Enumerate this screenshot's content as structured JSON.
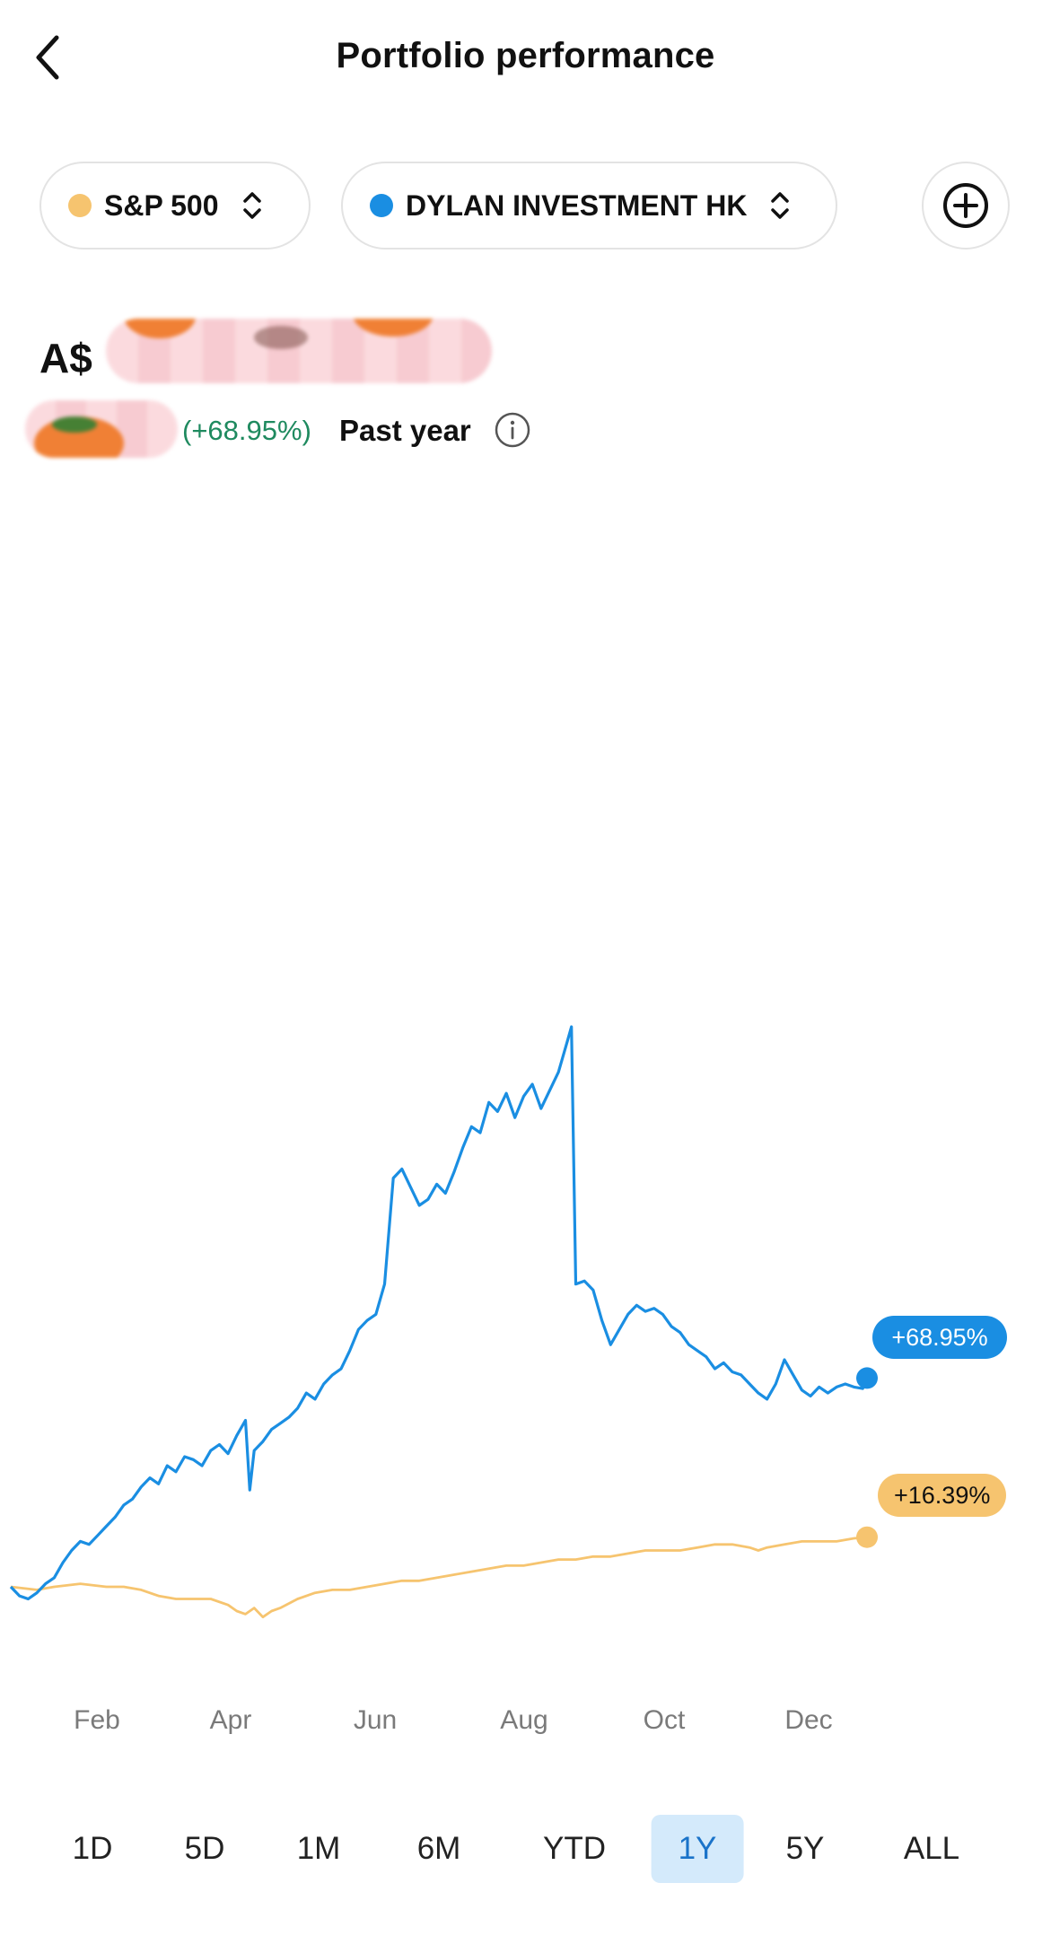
{
  "header": {
    "title": "Portfolio performance"
  },
  "comparison": [
    {
      "label": "S&P 500",
      "color": "#f6c46f"
    },
    {
      "label": "DYLAN INVESTMENT HK",
      "color": "#1a8ee2"
    }
  ],
  "icons": {
    "back": "back-chevron-icon",
    "sort": "sort-updown-icon",
    "add": "add-circle-icon",
    "info": "info-icon"
  },
  "summary": {
    "currency": "A$",
    "change_percent": "(+68.95%)",
    "period": "Past year"
  },
  "chart_data": {
    "type": "line",
    "x_ticks": [
      "Feb",
      "Apr",
      "Jun",
      "Aug",
      "Oct",
      "Dec"
    ],
    "series": [
      {
        "name": "DYLAN INVESTMENT HK",
        "color": "#1a8ee2",
        "end_label": "+68.95%",
        "points": [
          [
            0,
            0
          ],
          [
            1,
            -3
          ],
          [
            2,
            -4
          ],
          [
            3,
            -2
          ],
          [
            4,
            1
          ],
          [
            5,
            3
          ],
          [
            6,
            8
          ],
          [
            7,
            12
          ],
          [
            8,
            15
          ],
          [
            9,
            14
          ],
          [
            10,
            17
          ],
          [
            11,
            20
          ],
          [
            12,
            23
          ],
          [
            13,
            27
          ],
          [
            14,
            29
          ],
          [
            15,
            33
          ],
          [
            16,
            36
          ],
          [
            17,
            34
          ],
          [
            18,
            40
          ],
          [
            19,
            38
          ],
          [
            20,
            43
          ],
          [
            21,
            42
          ],
          [
            22,
            40
          ],
          [
            23,
            45
          ],
          [
            24,
            47
          ],
          [
            25,
            44
          ],
          [
            26,
            50
          ],
          [
            27,
            55
          ],
          [
            27.5,
            32
          ],
          [
            28,
            45
          ],
          [
            29,
            48
          ],
          [
            30,
            52
          ],
          [
            31,
            54
          ],
          [
            32,
            56
          ],
          [
            33,
            59
          ],
          [
            34,
            64
          ],
          [
            35,
            62
          ],
          [
            36,
            67
          ],
          [
            37,
            70
          ],
          [
            38,
            72
          ],
          [
            39,
            78
          ],
          [
            40,
            85
          ],
          [
            41,
            88
          ],
          [
            42,
            90
          ],
          [
            43,
            100
          ],
          [
            44,
            135
          ],
          [
            45,
            138
          ],
          [
            46,
            132
          ],
          [
            47,
            126
          ],
          [
            48,
            128
          ],
          [
            49,
            133
          ],
          [
            50,
            130
          ],
          [
            51,
            137
          ],
          [
            52,
            145
          ],
          [
            53,
            152
          ],
          [
            54,
            150
          ],
          [
            55,
            160
          ],
          [
            56,
            157
          ],
          [
            57,
            163
          ],
          [
            58,
            155
          ],
          [
            59,
            162
          ],
          [
            60,
            166
          ],
          [
            61,
            158
          ],
          [
            62,
            164
          ],
          [
            63,
            170
          ],
          [
            64,
            180
          ],
          [
            64.5,
            185
          ],
          [
            65,
            100
          ],
          [
            66,
            101
          ],
          [
            67,
            98
          ],
          [
            68,
            88
          ],
          [
            69,
            80
          ],
          [
            70,
            85
          ],
          [
            71,
            90
          ],
          [
            72,
            93
          ],
          [
            73,
            91
          ],
          [
            74,
            92
          ],
          [
            75,
            90
          ],
          [
            76,
            86
          ],
          [
            77,
            84
          ],
          [
            78,
            80
          ],
          [
            79,
            78
          ],
          [
            80,
            76
          ],
          [
            81,
            72
          ],
          [
            82,
            74
          ],
          [
            83,
            71
          ],
          [
            84,
            70
          ],
          [
            85,
            67
          ],
          [
            86,
            64
          ],
          [
            87,
            62
          ],
          [
            88,
            67
          ],
          [
            89,
            75
          ],
          [
            90,
            70
          ],
          [
            91,
            65
          ],
          [
            92,
            63
          ],
          [
            93,
            66
          ],
          [
            94,
            64
          ],
          [
            95,
            66
          ],
          [
            96,
            67
          ],
          [
            97,
            66
          ],
          [
            98,
            65.5
          ],
          [
            98.5,
            68.95
          ]
        ]
      },
      {
        "name": "S&P 500",
        "color": "#f6c46f",
        "end_label": "+16.39%",
        "points": [
          [
            0,
            0
          ],
          [
            3,
            -1
          ],
          [
            5,
            0
          ],
          [
            8,
            1
          ],
          [
            11,
            0
          ],
          [
            13,
            0
          ],
          [
            15,
            -1
          ],
          [
            17,
            -3
          ],
          [
            19,
            -4
          ],
          [
            21,
            -4
          ],
          [
            23,
            -4
          ],
          [
            25,
            -6
          ],
          [
            26,
            -8
          ],
          [
            27,
            -9
          ],
          [
            28,
            -7
          ],
          [
            29,
            -10
          ],
          [
            30,
            -8
          ],
          [
            31,
            -7
          ],
          [
            33,
            -4
          ],
          [
            35,
            -2
          ],
          [
            37,
            -1
          ],
          [
            39,
            -1
          ],
          [
            41,
            0
          ],
          [
            43,
            1
          ],
          [
            45,
            2
          ],
          [
            47,
            2
          ],
          [
            49,
            3
          ],
          [
            51,
            4
          ],
          [
            53,
            5
          ],
          [
            55,
            6
          ],
          [
            57,
            7
          ],
          [
            59,
            7
          ],
          [
            61,
            8
          ],
          [
            63,
            9
          ],
          [
            65,
            9
          ],
          [
            67,
            10
          ],
          [
            69,
            10
          ],
          [
            71,
            11
          ],
          [
            73,
            12
          ],
          [
            75,
            12
          ],
          [
            77,
            12
          ],
          [
            79,
            13
          ],
          [
            81,
            14
          ],
          [
            83,
            14
          ],
          [
            85,
            13
          ],
          [
            86,
            12
          ],
          [
            87,
            13
          ],
          [
            89,
            14
          ],
          [
            91,
            15
          ],
          [
            93,
            15
          ],
          [
            95,
            15
          ],
          [
            97,
            16
          ],
          [
            98.5,
            16.39
          ]
        ]
      }
    ]
  },
  "ranges": [
    "1D",
    "5D",
    "1M",
    "6M",
    "YTD",
    "1Y",
    "5Y",
    "ALL"
  ],
  "active_range": "1Y"
}
